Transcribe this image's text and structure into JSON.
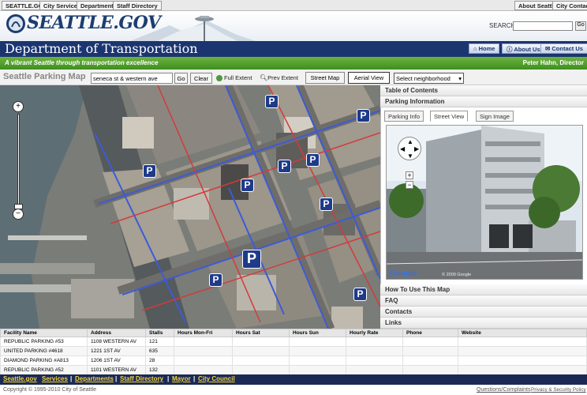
{
  "top_tabs": {
    "left": [
      "SEATTLE.GOV",
      "City Services",
      "Departments",
      "Staff Directory"
    ],
    "right": [
      "About Seattle",
      "City Contacts"
    ]
  },
  "header": {
    "logo": "SEATTLE.GOV",
    "search_label": "SEARCH:",
    "search_value": "",
    "go_label": "Go"
  },
  "dept": {
    "title": "Department of Transportation",
    "links": [
      "Home",
      "About Us",
      "Contact Us"
    ]
  },
  "tagline": "A vibrant Seattle through transportation excellence",
  "director": "Peter Hahn, Director",
  "tools": {
    "map_title": "Seattle Parking Map",
    "address_value": "seneca st & western ave",
    "go_label": "Go",
    "clear_label": "Clear",
    "full_extent": "Full Extent",
    "prev_extent": "Prev Extent",
    "street_map": "Street Map",
    "aerial_view": "Aerial View",
    "neighborhood_selected": "Select neighborhood"
  },
  "panel": {
    "table_of_contents": "Table of Contents",
    "parking_information": "Parking Information",
    "tabs": [
      "Parking Info",
      "Street View",
      "Sign Image"
    ],
    "active_tab": "Street View",
    "street_view_watermark": "© 2009 Google",
    "google_logo": "Google",
    "bottom_items": [
      "How To Use This Map",
      "FAQ",
      "Contacts",
      "Links"
    ]
  },
  "table": {
    "columns": [
      "Facility Name",
      "Address",
      "Stalls",
      "Hours Mon-Fri",
      "Hours Sat",
      "Hours Sun",
      "Hourly Rate",
      "Phone",
      "Website"
    ],
    "rows": [
      [
        "REPUBLIC PARKING #53",
        "1108 WESTERN AV",
        "121",
        "",
        "",
        "",
        "",
        "",
        ""
      ],
      [
        "UNITED PARKING #4618",
        "1221 1ST AV",
        "635",
        "",
        "",
        "",
        "",
        "",
        ""
      ],
      [
        "DIAMOND PARKING #A813",
        "1206 1ST AV",
        "28",
        "",
        "",
        "",
        "",
        "",
        ""
      ],
      [
        "REPUBLIC PARKING #52",
        "1101 WESTERN AV",
        "132",
        "",
        "",
        "",
        "",
        "",
        ""
      ]
    ]
  },
  "footer": {
    "links": [
      "Seattle.gov",
      "Services",
      "Departments",
      "Staff Directory",
      "Mayor",
      "City Council"
    ],
    "copyright": "Copyright © 1995-2010 City of Seattle",
    "right_links": [
      "Questions/Complaints",
      "Privacy & Security Policy"
    ]
  },
  "map": {
    "parking_marker_label": "P",
    "zoom_in": "+",
    "zoom_out": "−"
  },
  "colors": {
    "navy": "#1b3570",
    "green": "#4f9f2b",
    "footer_link": "#f4d23d"
  }
}
